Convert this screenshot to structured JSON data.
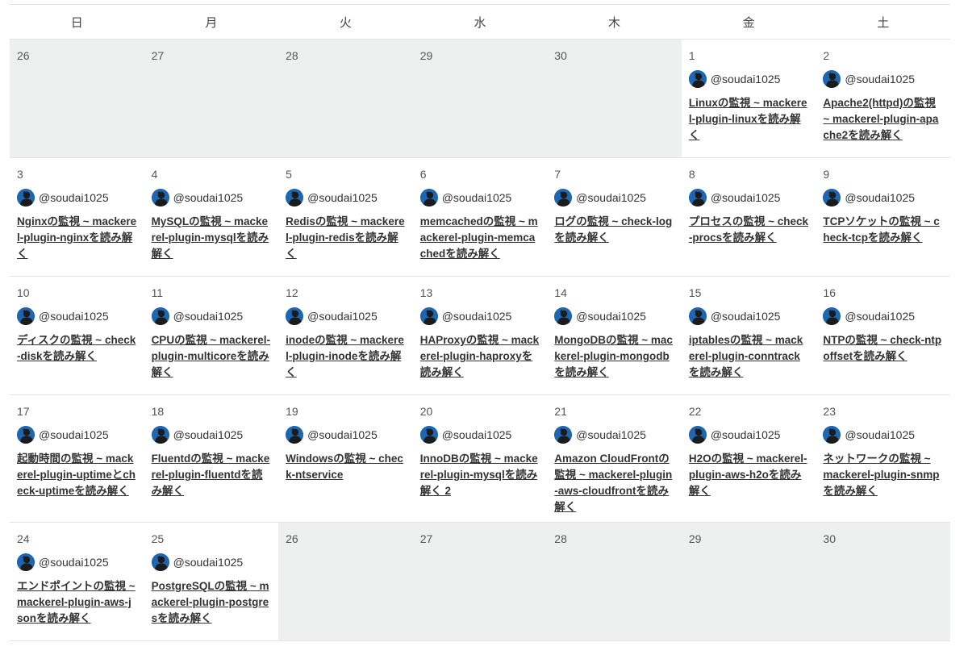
{
  "weekdays": [
    "日",
    "月",
    "火",
    "水",
    "木",
    "金",
    "土"
  ],
  "weeks": [
    [
      {
        "day": "26",
        "out": true
      },
      {
        "day": "27",
        "out": true
      },
      {
        "day": "28",
        "out": true
      },
      {
        "day": "29",
        "out": true
      },
      {
        "day": "30",
        "out": true
      },
      {
        "day": "1",
        "author": "@soudai1025",
        "title": "Linuxの監視 ~ mackerel-plugin-linuxを読み解く"
      },
      {
        "day": "2",
        "author": "@soudai1025",
        "title": "Apache2(httpd)の監視 ~ mackerel-plugin-apache2を読み解く"
      }
    ],
    [
      {
        "day": "3",
        "author": "@soudai1025",
        "title": "Nginxの監視 ~ mackerel-plugin-nginxを読み解く"
      },
      {
        "day": "4",
        "author": "@soudai1025",
        "title": "MySQLの監視 ~ mackerel-plugin-mysqlを読み解く"
      },
      {
        "day": "5",
        "author": "@soudai1025",
        "title": "Redisの監視 ~ mackerel-plugin-redisを読み解く"
      },
      {
        "day": "6",
        "author": "@soudai1025",
        "title": "memcachedの監視 ~ mackerel-plugin-memcachedを読み解く"
      },
      {
        "day": "7",
        "author": "@soudai1025",
        "title": "ログの監視 ~ check-logを読み解く"
      },
      {
        "day": "8",
        "author": "@soudai1025",
        "title": "プロセスの監視 ~ check-procsを読み解く"
      },
      {
        "day": "9",
        "author": "@soudai1025",
        "title": "TCPソケットの監視 ~ check-tcpを読み解く"
      }
    ],
    [
      {
        "day": "10",
        "author": "@soudai1025",
        "title": "ディスクの監視 ~ check-diskを読み解く"
      },
      {
        "day": "11",
        "author": "@soudai1025",
        "title": "CPUの監視 ~ mackerel-plugin-multicoreを読み解く"
      },
      {
        "day": "12",
        "author": "@soudai1025",
        "title": "inodeの監視 ~ mackerel-plugin-inodeを読み解く"
      },
      {
        "day": "13",
        "author": "@soudai1025",
        "title": "HAProxyの監視 ~ mackerel-plugin-haproxyを読み解く"
      },
      {
        "day": "14",
        "author": "@soudai1025",
        "title": "MongoDBの監視 ~ mackerel-plugin-mongodbを読み解く"
      },
      {
        "day": "15",
        "author": "@soudai1025",
        "title": "iptablesの監視 ~ mackerel-plugin-conntrackを読み解く"
      },
      {
        "day": "16",
        "author": "@soudai1025",
        "title": "NTPの監視 ~ check-ntpoffsetを読み解く"
      }
    ],
    [
      {
        "day": "17",
        "author": "@soudai1025",
        "title": "起動時間の監視 ~ mackerel-plugin-uptimeとcheck-uptimeを読み解く"
      },
      {
        "day": "18",
        "author": "@soudai1025",
        "title": "Fluentdの監視 ~ mackerel-plugin-fluentdを読み解く"
      },
      {
        "day": "19",
        "author": "@soudai1025",
        "title": "Windowsの監視 ~ check-ntservice"
      },
      {
        "day": "20",
        "author": "@soudai1025",
        "title": "InnoDBの監視 ~ mackerel-plugin-mysqlを読み解く 2"
      },
      {
        "day": "21",
        "author": "@soudai1025",
        "title": "Amazon CloudFrontの監視 ~ mackerel-plugin-aws-cloudfrontを読み解く"
      },
      {
        "day": "22",
        "author": "@soudai1025",
        "title": "H2Oの監視 ~ mackerel-plugin-aws-h2oを読み解く"
      },
      {
        "day": "23",
        "author": "@soudai1025",
        "title": "ネットワークの監視 ~ mackerel-plugin-snmpを読み解く"
      }
    ],
    [
      {
        "day": "24",
        "author": "@soudai1025",
        "title": "エンドポイントの監視 ~ mackerel-plugin-aws-jsonを読み解く"
      },
      {
        "day": "25",
        "author": "@soudai1025",
        "title": "PostgreSQLの監視 ~ mackerel-plugin-postgresを読み解く"
      },
      {
        "day": "26",
        "out": true
      },
      {
        "day": "27",
        "out": true
      },
      {
        "day": "28",
        "out": true
      },
      {
        "day": "29",
        "out": true
      },
      {
        "day": "30",
        "out": true
      }
    ]
  ],
  "avatar_icon": "user-avatar-icon",
  "colors": {
    "border": "#e3e3e3",
    "out_of_month_bg": "#eef0f0",
    "avatar_bg": "#1e66b0",
    "text": "#333333"
  }
}
